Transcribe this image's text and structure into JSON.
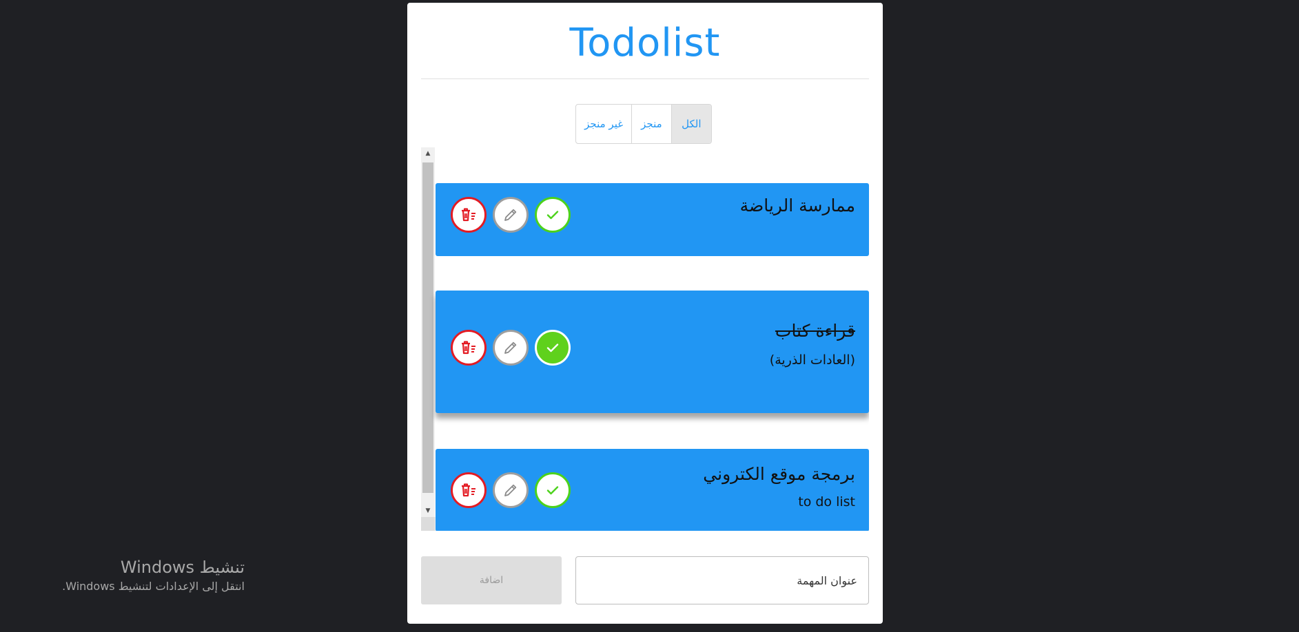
{
  "app": {
    "title": "Todolist"
  },
  "filters": [
    {
      "label": "الكل",
      "active": true
    },
    {
      "label": "منجز",
      "active": false
    },
    {
      "label": "غير منجز",
      "active": false
    }
  ],
  "tasks": [
    {
      "title": "ممارسة الرياضة",
      "description": "",
      "done": false
    },
    {
      "title": "قراءة كتاب",
      "description": "(العادات الذرية)",
      "done": true
    },
    {
      "title": "برمجة موقع الكتروني",
      "description": "to do list",
      "done": false
    }
  ],
  "form": {
    "add_label": "اضافة",
    "input_placeholder": "عنوان المهمة",
    "input_value": ""
  },
  "watermark": {
    "title": "تنشيط Windows",
    "subtitle": "انتقل إلى الإعدادات لتنشيط Windows."
  },
  "colors": {
    "accent": "#2196f3",
    "delete": "#e31b23",
    "done": "#4cd21b",
    "edit": "#9e9e9e",
    "background": "#1f2024"
  },
  "icons": {
    "delete": "trash-icon",
    "edit": "pencil-icon",
    "done": "check-icon"
  }
}
